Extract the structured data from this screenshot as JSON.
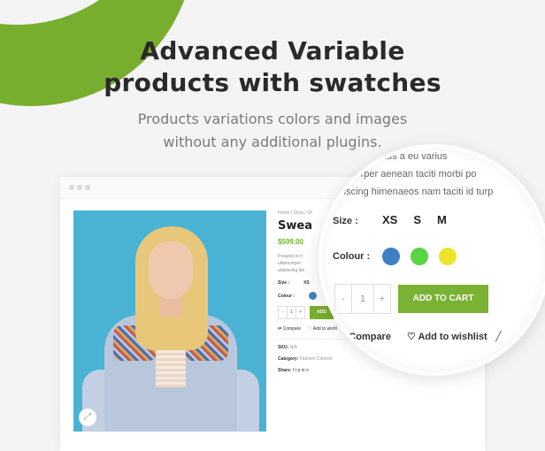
{
  "hero": {
    "title_line1": "Advanced Variable",
    "title_line2": "products with swatches",
    "subtitle_line1": "Products variations colors and images",
    "subtitle_line2": "without any additional plugins.",
    "accent_color": "#78ae2e"
  },
  "window": {
    "dots": [
      "dot",
      "dot",
      "dot"
    ]
  },
  "product": {
    "breadcrumb": "Home / Shop / Of",
    "title": "Swea",
    "price": "$599.00",
    "description_lines": [
      "Posuere in n",
      "ullamcorper",
      "adipiscing hin"
    ],
    "size_label": "Size :",
    "size_value": "XS",
    "colour_label": "Colour :",
    "qty_minus": "-",
    "qty_value": "1",
    "qty_plus": "+",
    "add_to_cart": "ADD",
    "compare_label": "Compare",
    "wishlist_label": "Add to wishl",
    "sku_label": "SKU:",
    "sku_value": "N/A",
    "category_label": "Category:",
    "category_value": "Fashion Colored",
    "share_label": "Share:",
    "share_icons": [
      "f",
      "t",
      "p",
      "in",
      "o"
    ],
    "zoom_icon": "expand-icon"
  },
  "magnifier": {
    "desc_lines": [
      "tus a eu varius",
      "corper aenean taciti morbi po",
      "ipiscing himenaeos nam taciti id turp"
    ],
    "size_label": "Size :",
    "sizes": [
      "XS",
      "S",
      "M"
    ],
    "colour_label": "Colour :",
    "colors": [
      {
        "name": "blue",
        "hex": "#3f7fc4"
      },
      {
        "name": "green",
        "hex": "#5ad444"
      },
      {
        "name": "yellow",
        "hex": "#ece52a"
      }
    ],
    "qty_minus": "-",
    "qty_value": "1",
    "qty_plus": "+",
    "add_to_cart": "ADD TO CART",
    "compare_label": "Compare",
    "wishlist_label": "Add to wishlist"
  }
}
